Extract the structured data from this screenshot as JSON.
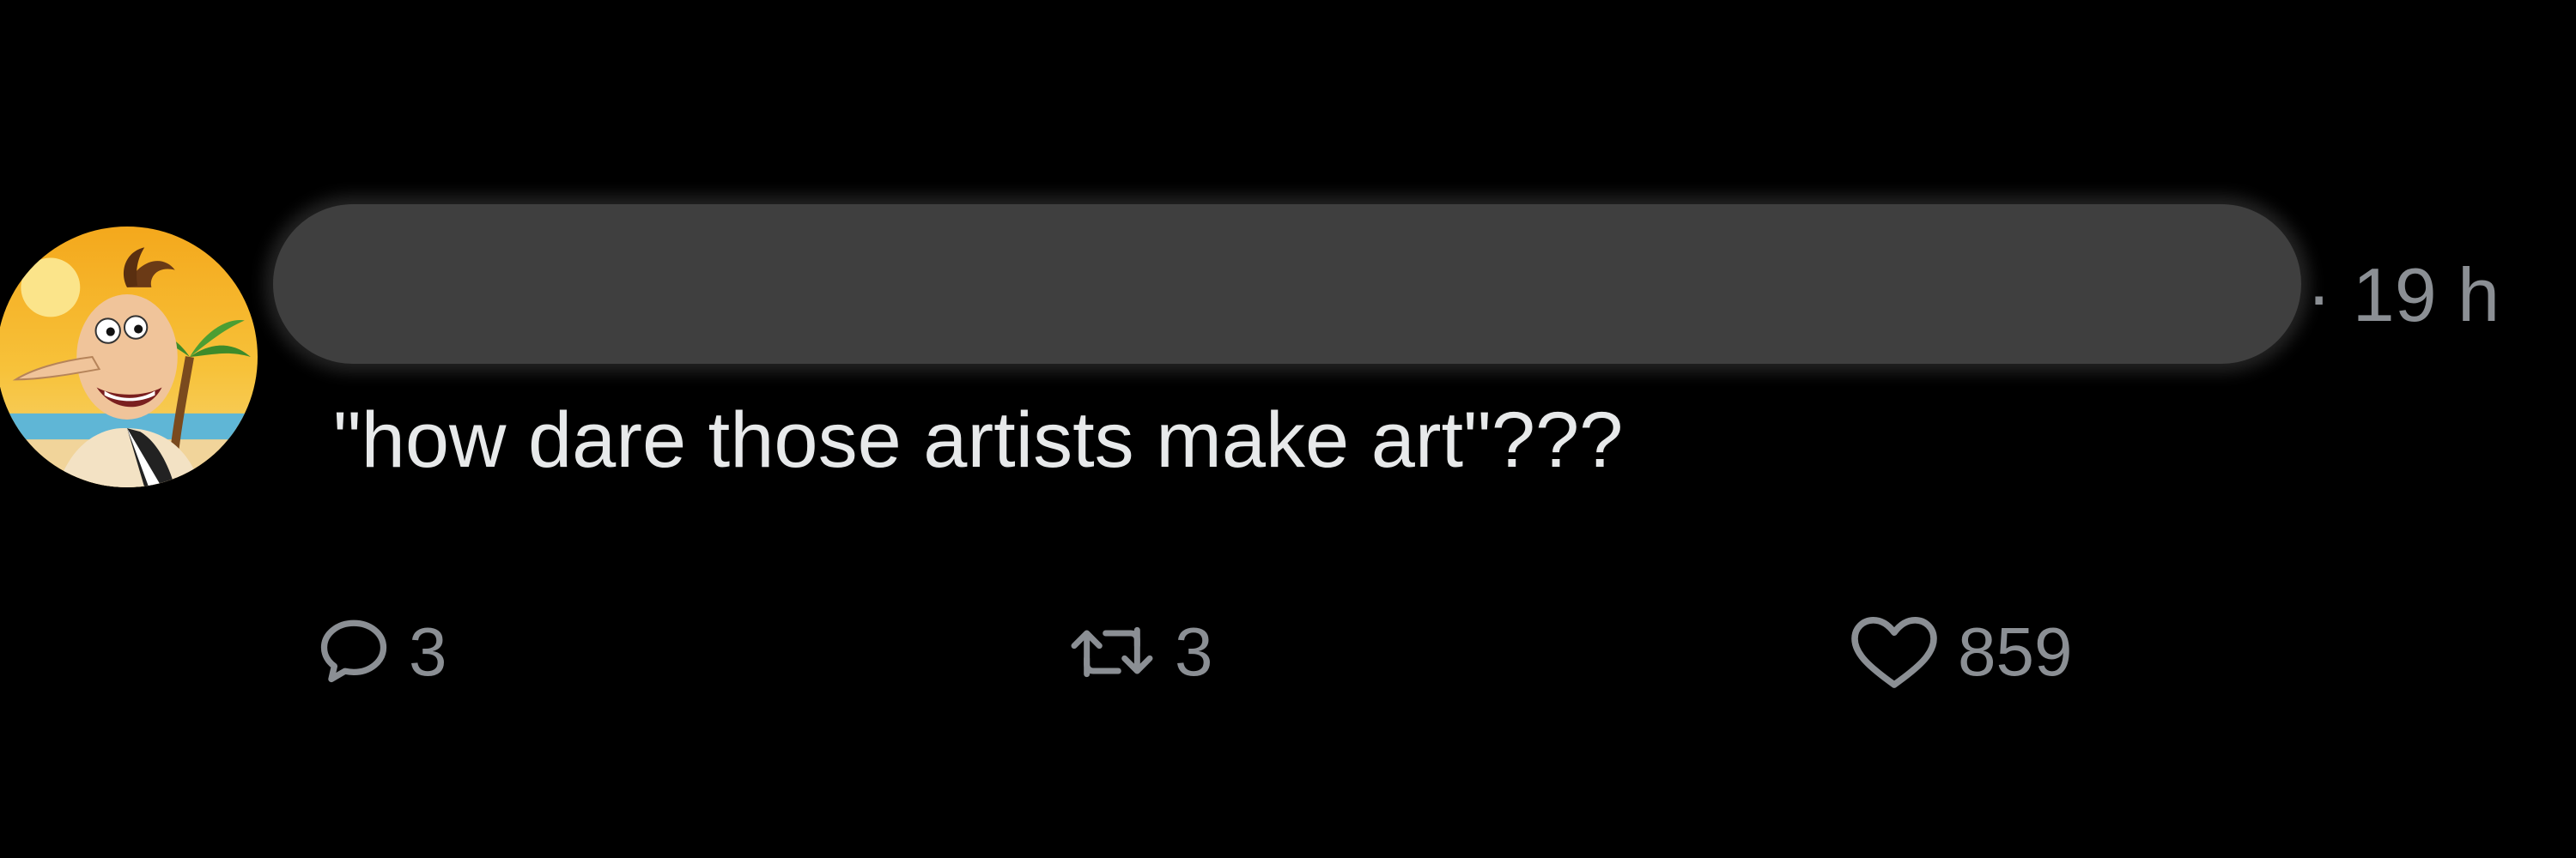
{
  "tweet": {
    "timestamp": "· 19 h",
    "text": "\"how dare those artists make art\"???",
    "author": {
      "avatar_icon": "cartoon-avatar-icon",
      "name_redacted": true
    },
    "actions": {
      "reply": {
        "icon": "reply-icon",
        "count": "3"
      },
      "retweet": {
        "icon": "retweet-icon",
        "count": "3"
      },
      "like": {
        "icon": "heart-icon",
        "count": "859"
      }
    }
  },
  "colors": {
    "background": "#000000",
    "text_primary": "#e7e9ea",
    "text_secondary": "#8b8f94",
    "redaction": "#3f3f3f"
  }
}
